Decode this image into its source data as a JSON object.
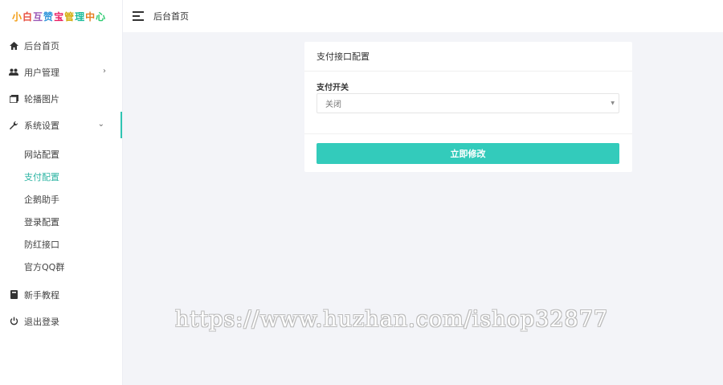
{
  "logo": {
    "chars": [
      {
        "text": "小",
        "color": "#f39c12"
      },
      {
        "text": "白",
        "color": "#e74c3c"
      },
      {
        "text": "互",
        "color": "#9b59b6"
      },
      {
        "text": "赞",
        "color": "#3498db"
      },
      {
        "text": "宝",
        "color": "#e91e63"
      },
      {
        "text": "管",
        "color": "#f1c40f"
      },
      {
        "text": "理",
        "color": "#1abc9c"
      },
      {
        "text": "中",
        "color": "#e67e22"
      },
      {
        "text": "心",
        "color": "#2ecc71"
      }
    ]
  },
  "sidebar": {
    "items": [
      {
        "label": "后台首页",
        "icon": "home-icon"
      },
      {
        "label": "用户管理",
        "icon": "users-icon"
      },
      {
        "label": "轮播图片",
        "icon": "images-icon"
      },
      {
        "label": "系统设置",
        "icon": "wrench-icon"
      },
      {
        "label": "新手教程",
        "icon": "book-icon"
      },
      {
        "label": "退出登录",
        "icon": "power-icon"
      }
    ],
    "submenu": [
      {
        "label": "网站配置"
      },
      {
        "label": "支付配置"
      },
      {
        "label": "企鹅助手"
      },
      {
        "label": "登录配置"
      },
      {
        "label": "防红接口"
      },
      {
        "label": "官方QQ群"
      }
    ],
    "accent_color": "#2fc4b2"
  },
  "topbar": {
    "breadcrumb": "后台首页"
  },
  "panel": {
    "title": "支付接口配置",
    "field_label": "支付开关",
    "select_value": "关闭",
    "submit_label": "立即修改",
    "button_color": "#33cbbb"
  },
  "watermark": "https://www.huzhan.com/ishop32877"
}
